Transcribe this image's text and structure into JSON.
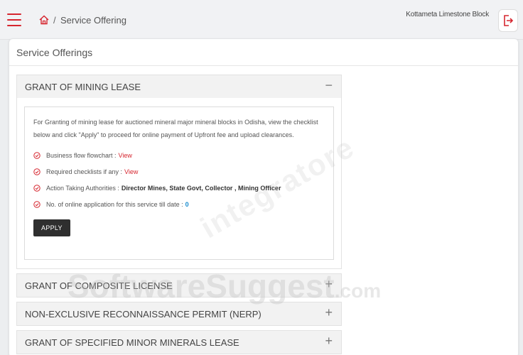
{
  "header": {
    "breadcrumb_sep": "/",
    "breadcrumb_page": "Service Offering",
    "block_name": "Kottameta Limestone Block"
  },
  "card": {
    "title": "Service Offerings"
  },
  "accordion": {
    "panels": [
      {
        "title": "GRANT OF MINING LEASE",
        "toggle": "−",
        "expanded": true,
        "description": "For Granting of mining lease for auctioned mineral major mineral blocks in Odisha, view the checklist below and click \"Apply\" to proceed for online payment of Upfront fee and upload clearances.",
        "items": [
          {
            "label": "Business flow flowchart :",
            "link": "View"
          },
          {
            "label": "Required checklists if any :",
            "link": "View"
          },
          {
            "label": "Action Taking Authorities :",
            "value": "Director Mines, State Govt, Collector , Mining Officer"
          },
          {
            "label": "No. of online application for this service till date :",
            "count": "0"
          }
        ],
        "apply_label": "APPLY"
      },
      {
        "title": "GRANT OF COMPOSITE LICENSE",
        "toggle": "+",
        "expanded": false
      },
      {
        "title": "NON-EXCLUSIVE RECONNAISSANCE PERMIT (NERP)",
        "toggle": "+",
        "expanded": false
      },
      {
        "title": "GRANT OF SPECIFIED MINOR MINERALS LEASE",
        "toggle": "+",
        "expanded": false
      }
    ]
  },
  "watermarks": {
    "integratore": "integratore",
    "brand": "SoftwareSuggest",
    "brand_suffix": ".com"
  },
  "colors": {
    "accent": "#d6262f",
    "count": "#1a8ccf",
    "apply_bg": "#2f2f2f"
  },
  "icons": [
    "hamburger-icon",
    "home-icon",
    "logout-icon",
    "check-circle-icon"
  ]
}
